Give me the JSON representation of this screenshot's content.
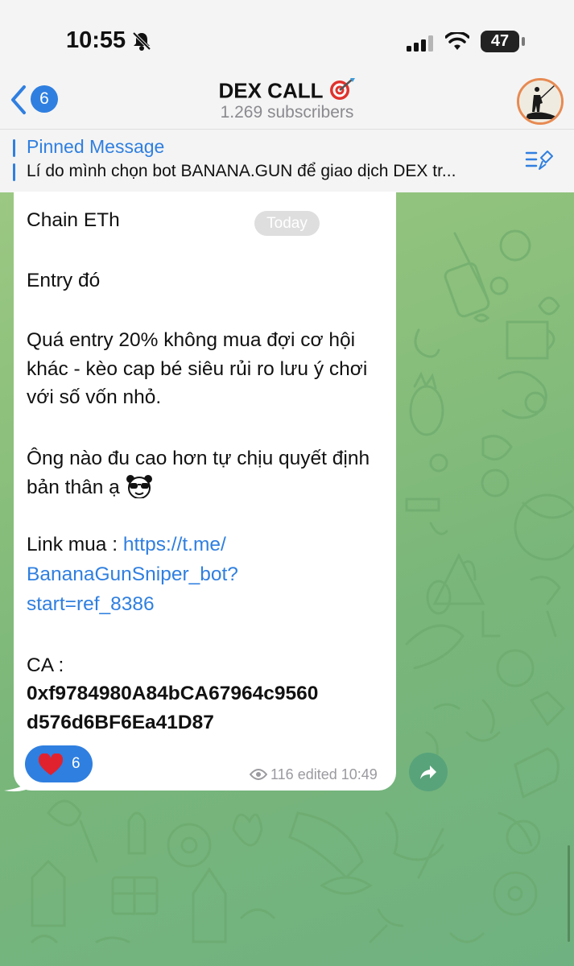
{
  "status_bar": {
    "time": "10:55",
    "battery": "47",
    "icons": [
      "bell-off-icon",
      "signal-icon",
      "wifi-icon",
      "battery-icon"
    ]
  },
  "header": {
    "back_count": "6",
    "title": "DEX CALL",
    "title_emoji": "target-icon",
    "subscribers": "1.269 subscribers"
  },
  "pinned": {
    "label": "Pinned Message",
    "text": "Lí do mình chọn bot BANANA.GUN để giao dịch DEX tr..."
  },
  "message": {
    "date_pill": "Today",
    "line_chain": "Chain ETh",
    "line_entry": "Entry đó",
    "para_warning": "Quá entry 20% không mua đợi cơ hội khác - kèo cap bé siêu rủi ro lưu ý chơi với số vốn nhỏ.",
    "para_risk": "Ông nào đu cao hơn tự chịu quyết định bản thân ạ",
    "emoji_sunglasses": "panda-sunglasses-icon",
    "link_label": "Link mua : ",
    "link_line1": "https://t.me/",
    "link_line2": "BananaGunSniper_bot?",
    "link_line3": "start=ref_8386",
    "ca_label": "CA :",
    "ca_line1": "0xf9784980A84bCA67964c9560",
    "ca_line2": "d576d6BF6Ea41D87",
    "reaction_count": "6",
    "views": "116",
    "edited_time": "edited 10:49"
  },
  "colors": {
    "accent": "#2f7fe0",
    "share_button": "#58a37a",
    "wallpaper": "#8ec17c"
  }
}
